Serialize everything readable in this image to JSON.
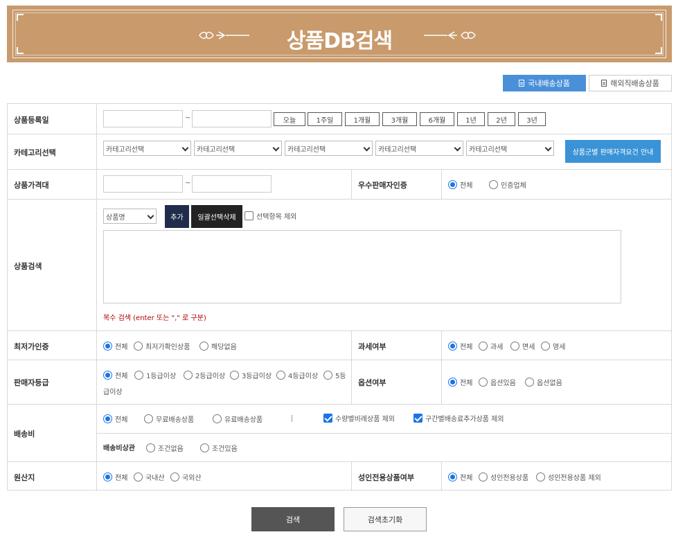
{
  "banner": {
    "title": "상품DB검색"
  },
  "tabs": {
    "domestic": "국내배송상품",
    "overseas": "해외직배송상품"
  },
  "labels": {
    "reg_date": "상품등록일",
    "category": "카테고리선택",
    "price_range": "상품가격대",
    "excellent_seller": "우수판매자인증",
    "product_search": "상품검색",
    "lowest_price": "최저가인증",
    "tax": "과세여부",
    "seller_grade": "판매자등급",
    "option": "옵션여부",
    "shipping": "배송비",
    "shipping_policy": "배송비상관",
    "origin": "원산지",
    "adult": "성인전용상품여부"
  },
  "common": {
    "tilde": "~"
  },
  "date_buttons": [
    "오늘",
    "1주일",
    "1개월",
    "3개월",
    "6개월",
    "1년",
    "2년",
    "3년"
  ],
  "category": {
    "selects": [
      "카테고리선택",
      "카테고리선택",
      "카테고리선택",
      "카테고리선택",
      "카테고리선택"
    ],
    "guide_button": "상품군별 판매자격요건 안내"
  },
  "excellent_seller": {
    "options": [
      "전체",
      "인증업체"
    ],
    "selected": 0
  },
  "search": {
    "type_select": "상품명",
    "add_button": "추가",
    "bulk_delete_button": "일괄선택삭제",
    "exclude_selected": "선택항목 제외",
    "hint": "복수 검색 (enter 또는 \",\" 로 구분)"
  },
  "lowest_price": {
    "options": [
      "전체",
      "최저가확인상품",
      "해당없음"
    ],
    "selected": 0
  },
  "tax": {
    "options": [
      "전체",
      "과세",
      "면세",
      "영세"
    ],
    "selected": 0
  },
  "seller_grade": {
    "options": [
      "전체",
      "1등급이상",
      "2등급이상",
      "3등급이상",
      "4등급이상",
      "5등"
    ],
    "wrap": "급이상",
    "selected": 0
  },
  "option": {
    "options": [
      "전체",
      "옵션있음",
      "옵션없음"
    ],
    "selected": 0
  },
  "shipping": {
    "options": [
      "전체",
      "무료배송상품",
      "유료배송상품"
    ],
    "selected": 0,
    "exclude_quantity": "수량별비례상품 제외",
    "exclude_region": "구간별배송료추가상품 제외"
  },
  "shipping_policy": {
    "options": [
      "조건없음",
      "조건있음"
    ]
  },
  "origin": {
    "options": [
      "전체",
      "국내산",
      "국외산"
    ],
    "selected": 0
  },
  "adult": {
    "options": [
      "전체",
      "성인전용상품",
      "성인전용상품 제외"
    ],
    "selected": 0
  },
  "footer": {
    "search_button": "검색",
    "reset_button": "검색초기화"
  },
  "colors": {
    "banner": "#c89a6c",
    "accent": "#1a73e8",
    "tab_active": "#4a90d9",
    "guide_button": "#3a93d6",
    "add_button": "#1f2d4a",
    "bulk_delete_button": "#222222",
    "search_button": "#555555"
  }
}
